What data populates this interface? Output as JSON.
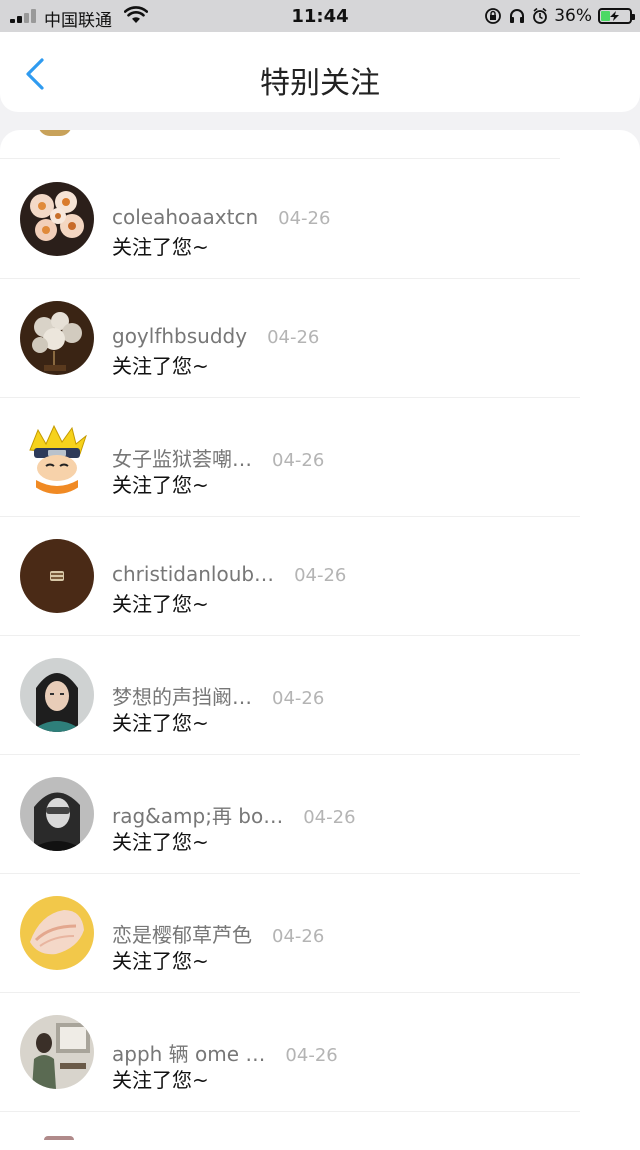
{
  "status_bar": {
    "carrier": "中国联通",
    "time": "11:44",
    "battery_percent": "36%",
    "battery_level": 0.36,
    "battery_color": "#4cd964",
    "icons": [
      "signal-icon",
      "wifi-icon",
      "rotation-lock-icon",
      "headphones-icon",
      "alarm-icon",
      "battery-icon"
    ]
  },
  "nav": {
    "title": "特别关注",
    "back_icon": "chevron-left-icon",
    "accent_color": "#2f9bf0"
  },
  "items": [
    {
      "name": "coleahoaaxtcn",
      "date": "04-26",
      "message": "关注了您~",
      "avatar": "flowers"
    },
    {
      "name": "goylfhbsuddy",
      "date": "04-26",
      "message": "关注了您~",
      "avatar": "dandelion"
    },
    {
      "name": "女子监狱荟嘲…",
      "date": "04-26",
      "message": "关注了您~",
      "avatar": "cartoon"
    },
    {
      "name": "christidanloub…",
      "date": "04-26",
      "message": "关注了您~",
      "avatar": "dark-brown"
    },
    {
      "name": "梦想的声挡阚…",
      "date": "04-26",
      "message": "关注了您~",
      "avatar": "woman-portrait"
    },
    {
      "name": "rag&amp;再 bo…",
      "date": "04-26",
      "message": "关注了您~",
      "avatar": "bw-portrait"
    },
    {
      "name": "恋是樱郁草芦色",
      "date": "04-26",
      "message": "关注了您~",
      "avatar": "seashell"
    },
    {
      "name": "apph 辆 ome …",
      "date": "04-26",
      "message": "关注了您~",
      "avatar": "room-scene"
    }
  ]
}
